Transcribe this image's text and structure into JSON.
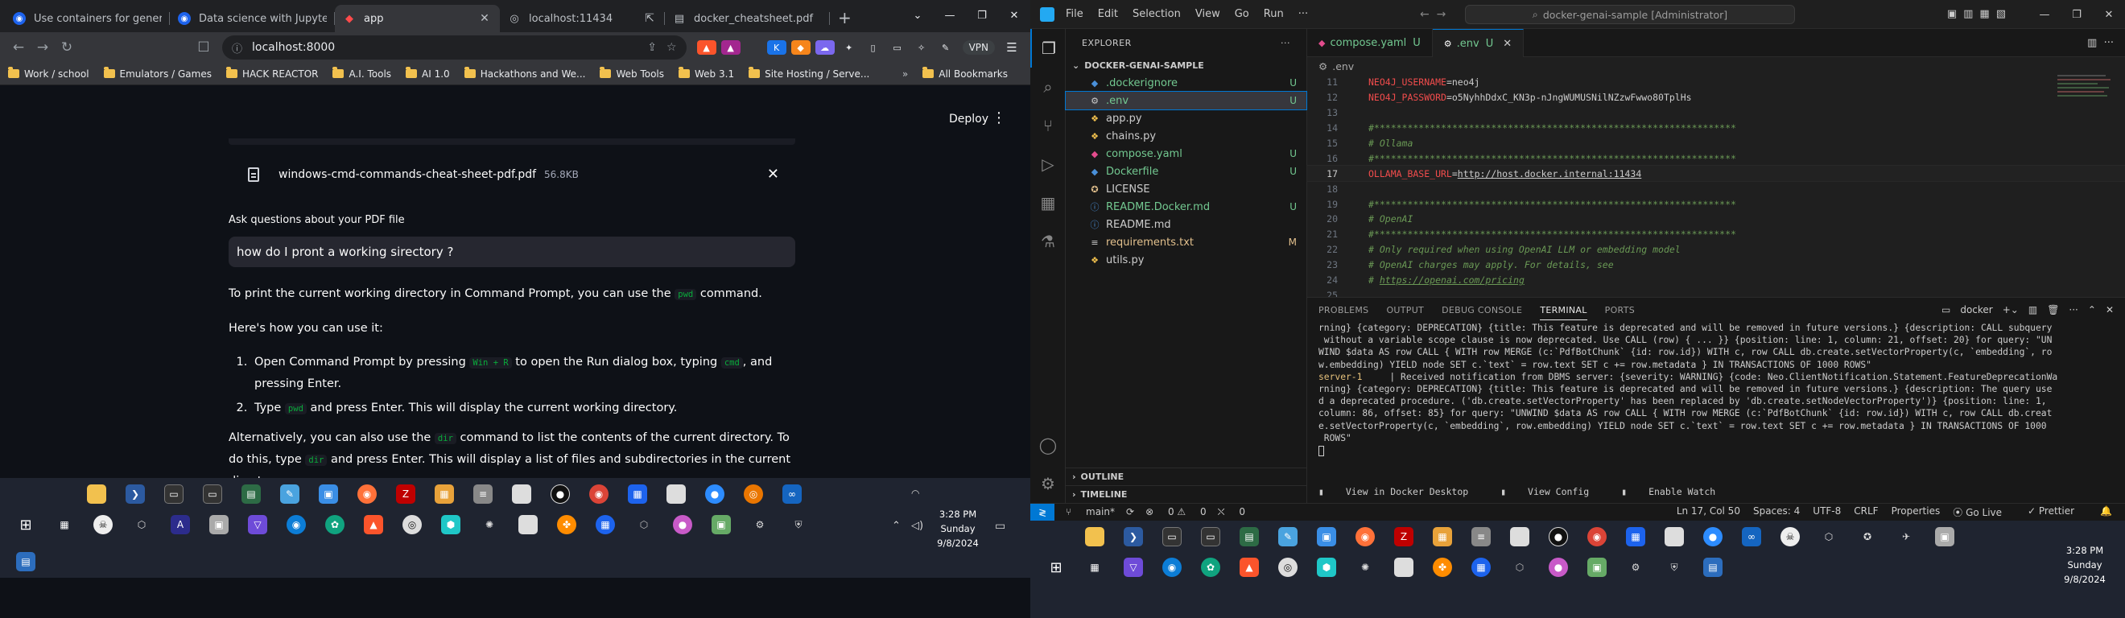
{
  "chrome": {
    "tabs": [
      {
        "title": "Use containers for generative",
        "favicon_color": "#1d63ed",
        "favicon_glyph": "◉"
      },
      {
        "title": "Data science with JupyterLab:",
        "favicon_color": "#1d63ed",
        "favicon_glyph": "◉"
      },
      {
        "title": "app",
        "favicon_color": "#ff4b4b",
        "favicon_glyph": "◆",
        "active": true
      },
      {
        "title": "localhost:11434",
        "favicon_color": "#5f6368",
        "favicon_glyph": "◎"
      },
      {
        "title": "docker_cheatsheet.pdf",
        "favicon_color": "#5f6368",
        "favicon_glyph": "▤"
      }
    ],
    "url": "localhost:8000",
    "vpn_label": "VPN",
    "bookmarks": [
      "Work / school",
      "Emulators / Games",
      "HACK REACTOR",
      "A.I. Tools",
      "AI 1.0",
      "Hackathons and We...",
      "Web Tools",
      "Web 3.1",
      "Site Hosting / Serve..."
    ],
    "all_bookmarks": "All Bookmarks"
  },
  "app": {
    "deploy_label": "Deploy",
    "file_name": "windows-cmd-commands-cheat-sheet-pdf.pdf",
    "file_size": "56.8KB",
    "question_label": "Ask questions about your PDF file",
    "question_value": "how do I pront a working sirectory ?",
    "answer": {
      "p1_a": "To print the current working directory in Command Prompt, you can use the ",
      "p1_code": "pwd",
      "p1_b": " command.",
      "p2": "Here's how you can use it:",
      "li1_a": "Open Command Prompt by pressing ",
      "li1_code1": "Win + R",
      "li1_b": " to open the Run dialog box, typing ",
      "li1_code2": "cmd",
      "li1_c": ", and pressing Enter.",
      "li2_a": "Type ",
      "li2_code": "pwd",
      "li2_b": " and press Enter. This will display the current working directory.",
      "p3_a": "Alternatively, you can also use the ",
      "p3_code1": "dir",
      "p3_b": " command to list the contents of the current directory. To do this, type ",
      "p3_code2": "dir",
      "p3_c": " and press Enter. This will display a list of files and subdirectories in the current directory."
    }
  },
  "taskbar_left": {
    "time": "3:28 PM",
    "day": "Sunday",
    "date": "9/8/2024"
  },
  "vscode": {
    "menu": [
      "File",
      "Edit",
      "Selection",
      "View",
      "Go",
      "Run",
      "···"
    ],
    "search_text": "docker-genai-sample [Administrator]",
    "explorer_title": "EXPLORER",
    "folder_name": "DOCKER-GENAI-SAMPLE",
    "files": [
      {
        "name": ".dockerignore",
        "status": "U",
        "icon": "◆",
        "icon_color": "#4a90d9",
        "color": "g"
      },
      {
        "name": ".env",
        "status": "U",
        "icon": "⚙",
        "icon_color": "#cccccc",
        "color": "g",
        "selected": true
      },
      {
        "name": "app.py",
        "status": "",
        "icon": "❖",
        "icon_color": "#f2c14e",
        "color": ""
      },
      {
        "name": "chains.py",
        "status": "",
        "icon": "❖",
        "icon_color": "#f2c14e",
        "color": ""
      },
      {
        "name": "compose.yaml",
        "status": "U",
        "icon": "◆",
        "icon_color": "#e34c8d",
        "color": "g"
      },
      {
        "name": "Dockerfile",
        "status": "U",
        "icon": "◆",
        "icon_color": "#4a90d9",
        "color": "g"
      },
      {
        "name": "LICENSE",
        "status": "",
        "icon": "✪",
        "icon_color": "#e2c08d",
        "color": ""
      },
      {
        "name": "README.Docker.md",
        "status": "U",
        "icon": "ⓘ",
        "icon_color": "#4a90d9",
        "color": "g"
      },
      {
        "name": "README.md",
        "status": "",
        "icon": "ⓘ",
        "icon_color": "#4a90d9",
        "color": ""
      },
      {
        "name": "requirements.txt",
        "status": "M",
        "icon": "≡",
        "icon_color": "#cccccc",
        "color": "y"
      },
      {
        "name": "utils.py",
        "status": "",
        "icon": "❖",
        "icon_color": "#f2c14e",
        "color": ""
      }
    ],
    "outline_label": "OUTLINE",
    "timeline_label": "TIMELINE",
    "editor_tabs": [
      {
        "name": "compose.yaml",
        "status": "U",
        "icon": "◆",
        "icon_color": "#e34c8d"
      },
      {
        "name": ".env",
        "status": "U",
        "icon": "⚙",
        "icon_color": "#cccccc",
        "active": true
      }
    ],
    "breadcrumb": ".env",
    "code_lines": [
      {
        "n": "11",
        "key": "NEO4J_USERNAME",
        "val": "=neo4j"
      },
      {
        "n": "12",
        "key": "NEO4J_PASSWORD",
        "val": "=o5NyhhDdxC_KN3p-nJngWUMUSNilNZzwFwwo80TplHs"
      },
      {
        "n": "13",
        "text": ""
      },
      {
        "n": "14",
        "comment": "#*****************************************************************"
      },
      {
        "n": "15",
        "comment": "# Ollama"
      },
      {
        "n": "16",
        "comment": "#*****************************************************************"
      },
      {
        "n": "17",
        "key": "OLLAMA_BASE_URL",
        "val": "=",
        "link": "http://host.docker.internal:11434",
        "current": true
      },
      {
        "n": "18",
        "text": ""
      },
      {
        "n": "19",
        "comment": "#*****************************************************************"
      },
      {
        "n": "20",
        "comment": "# OpenAI"
      },
      {
        "n": "21",
        "comment": "#*****************************************************************"
      },
      {
        "n": "22",
        "comment": "# Only required when using OpenAI LLM or embedding model"
      },
      {
        "n": "23",
        "comment": "# OpenAI charges may apply. For details, see"
      },
      {
        "n": "24",
        "comment": "# ",
        "comment_link": "https://openai.com/pricing"
      },
      {
        "n": "25",
        "text": ""
      }
    ],
    "panel_tabs": [
      "PROBLEMS",
      "OUTPUT",
      "DEBUG CONSOLE",
      "TERMINAL",
      "PORTS"
    ],
    "terminal_name": "docker",
    "terminal_lines": [
      {
        "text": "rning} {category: DEPRECATION} {title: This feature is deprecated and will be removed in future versions.} {description: CALL subquery"
      },
      {
        "text": " without a variable scope clause is now deprecated. Use CALL (row) { ... }} {position: line: 1, column: 21, offset: 20} for query: \"UN"
      },
      {
        "text": "WIND $data AS row CALL { WITH row MERGE (c:`PdfBotChunk` {id: row.id}) WITH c, row CALL db.create.setVectorProperty(c, `embedding`, ro"
      },
      {
        "text": "w.embedding) YIELD node SET c.`text` = row.text SET c += row.metadata } IN TRANSACTIONS OF 1000 ROWS\""
      },
      {
        "prefix": "server-1",
        "text": "     | Received notification from DBMS server: {severity: WARNING} {code: Neo.ClientNotification.Statement.FeatureDeprecationWa"
      },
      {
        "text": "rning} {category: DEPRECATION} {title: This feature is deprecated and will be removed in future versions.} {description: The query use"
      },
      {
        "text": "d a deprecated procedure. ('db.create.setVectorProperty' has been replaced by 'db.create.setNodeVectorProperty')} {position: line: 1,"
      },
      {
        "text": "column: 86, offset: 85} for query: \"UNWIND $data AS row CALL { WITH row MERGE (c:`PdfBotChunk` {id: row.id}) WITH c, row CALL db.creat"
      },
      {
        "text": "e.setVectorProperty(c, `embedding`, row.embedding) YIELD node SET c.`text` = row.text SET c += row.metadata } IN TRANSACTIONS OF 1000"
      },
      {
        "text": " ROWS\""
      }
    ],
    "terminal_links": [
      "View in Docker Desktop",
      "View Config",
      "Enable Watch"
    ],
    "status": {
      "branch": "main*",
      "sync": "⟳",
      "errors": "0",
      "warnings": "0",
      "ports": "0",
      "position": "Ln 17, Col 50",
      "spaces": "Spaces: 4",
      "encoding": "UTF-8",
      "eol": "CRLF",
      "properties": "Properties",
      "golive": "Go Live",
      "prettier": "Prettier"
    }
  },
  "taskbar_right": {
    "time": "3:28 PM",
    "day": "Sunday",
    "date": "9/8/2024"
  }
}
